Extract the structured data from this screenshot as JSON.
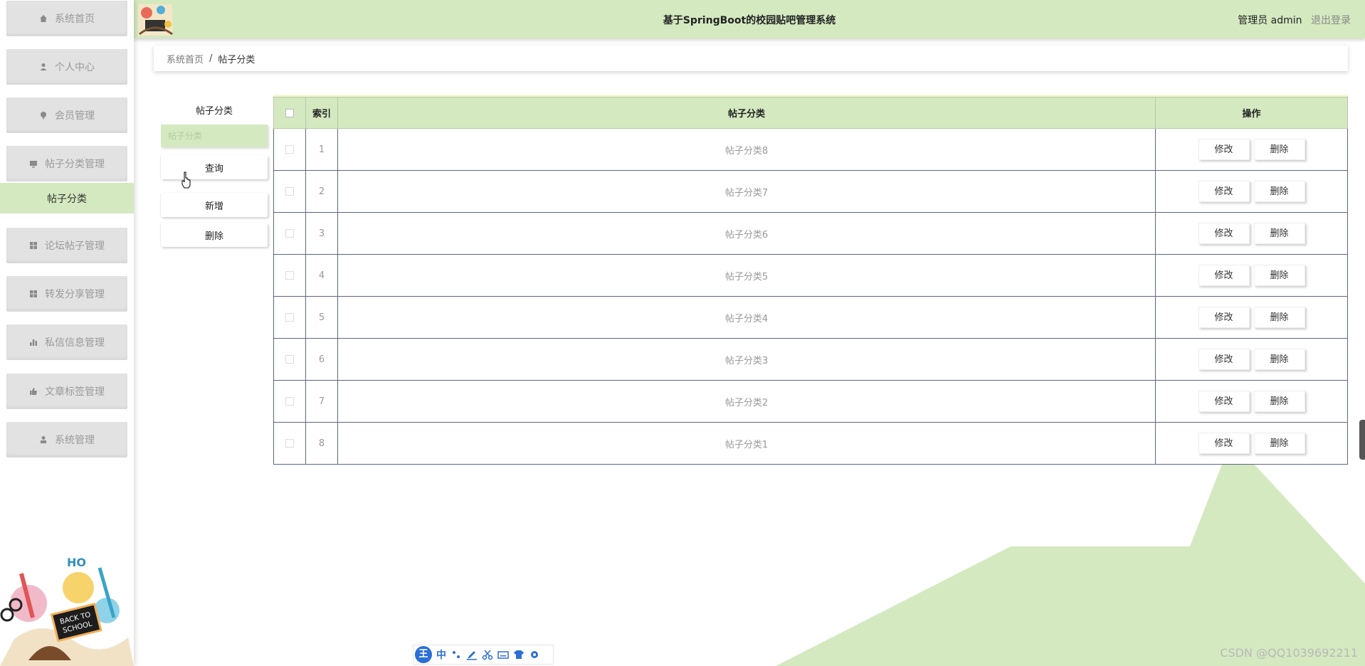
{
  "app": {
    "title": "基于SpringBoot的校园贴吧管理系统"
  },
  "header": {
    "user_role": "管理员 admin",
    "logout": "退出登录"
  },
  "sidebar": {
    "items": [
      {
        "label": "系统首页",
        "icon": "home-icon"
      },
      {
        "label": "个人中心",
        "icon": "user-icon"
      },
      {
        "label": "会员管理",
        "icon": "pin-icon"
      },
      {
        "label": "帖子分类管理",
        "icon": "monitor-icon"
      },
      {
        "label": "论坛帖子管理",
        "icon": "grid-icon"
      },
      {
        "label": "转发分享管理",
        "icon": "grid-icon"
      },
      {
        "label": "私信信息管理",
        "icon": "bar-chart-icon"
      },
      {
        "label": "文章标签管理",
        "icon": "thumbs-up-icon"
      },
      {
        "label": "系统管理",
        "icon": "person-icon"
      }
    ],
    "active_sub_item": "帖子分类"
  },
  "breadcrumb": {
    "home": "系统首页",
    "separator": "/",
    "current": "帖子分类"
  },
  "filter": {
    "title": "帖子分类",
    "placeholder": "帖子分类",
    "buttons": {
      "search": "查询",
      "add": "新增",
      "delete": "删除"
    }
  },
  "table": {
    "headers": {
      "index": "索引",
      "category": "帖子分类",
      "actions": "操作"
    },
    "rows": [
      {
        "index": "1",
        "category": "帖子分类8"
      },
      {
        "index": "2",
        "category": "帖子分类7"
      },
      {
        "index": "3",
        "category": "帖子分类6"
      },
      {
        "index": "4",
        "category": "帖子分类5"
      },
      {
        "index": "5",
        "category": "帖子分类4"
      },
      {
        "index": "6",
        "category": "帖子分类3"
      },
      {
        "index": "7",
        "category": "帖子分类2"
      },
      {
        "index": "8",
        "category": "帖子分类1"
      }
    ],
    "row_actions": {
      "edit": "修改",
      "delete": "删除"
    }
  },
  "decoration": {
    "art_text": "BACK TO SCHOOL"
  },
  "ime_toolbar": {
    "logo": "王",
    "lang": "中"
  },
  "watermark": "CSDN @QQ1039692211",
  "colors": {
    "accent": "#d4e9c0",
    "table_border": "#5c6680"
  }
}
